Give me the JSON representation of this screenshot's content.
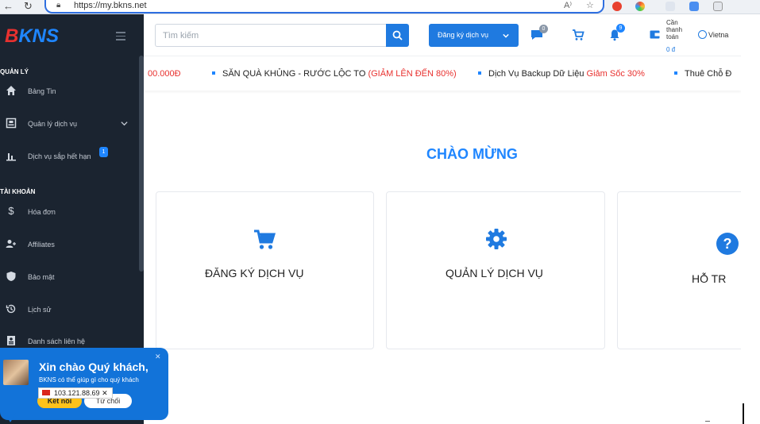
{
  "browser": {
    "url": "https://my.bkns.net"
  },
  "sidebar": {
    "logo_b": "B",
    "logo_rest": "KNS",
    "sections": [
      {
        "title": "QUẢN LÝ",
        "items": [
          {
            "label": "Bảng Tin",
            "icon": "home-icon"
          },
          {
            "label": "Quản lý dịch vụ",
            "icon": "id-card-icon"
          },
          {
            "label": "Dịch vụ sắp hết hạn",
            "icon": "bar-chart-icon",
            "badge": "1"
          }
        ]
      },
      {
        "title": "TÀI KHOẢN",
        "items": [
          {
            "label": "Hóa đơn",
            "icon": "dollar-icon"
          },
          {
            "label": "Affiliates",
            "icon": "users-icon"
          },
          {
            "label": "Bảo mật",
            "icon": "shield-icon"
          },
          {
            "label": "Lịch sử",
            "icon": "history-icon"
          },
          {
            "label": "Danh sách liên hệ",
            "icon": "contact-list-icon"
          }
        ]
      }
    ]
  },
  "header": {
    "search_placeholder": "Tìm kiếm",
    "register_label": "Đăng ký dịch vụ",
    "chat_badge": "0",
    "notif_badge": "9",
    "wallet_label": "Cần thanh toán",
    "wallet_value": "0 đ",
    "language": "Vietna"
  },
  "ticker": {
    "item0": "00.000Đ",
    "item1_prefix": "SĂN QUÀ KHỦNG - RƯỚC LỘC TO",
    "item1_red": "(GIẢM LÊN ĐẾN 80%)",
    "item2_prefix": "Dịch Vụ Backup Dữ Liệu",
    "item2_red": "Giảm Sốc 30%",
    "item3": "Thuê Chỗ Đ"
  },
  "main": {
    "welcome": "CHÀO MỪNG",
    "cards": [
      {
        "title": "ĐĂNG KÝ DỊCH VỤ",
        "icon": "cart-icon"
      },
      {
        "title": "QUẢN LÝ DỊCH VỤ",
        "icon": "gear-icon"
      },
      {
        "title": "HỖ TR",
        "icon": "help-icon"
      }
    ]
  },
  "chat": {
    "title": "Xin chào Quý khách,",
    "subtitle": "BKNS có thể giúp gì cho quý khách",
    "connect": "Kết nối",
    "refuse": "Từ chối",
    "ip": "103.121.88.69",
    "ip_close": "✕",
    "close": "✕"
  },
  "colors": {
    "accent": "#1f86ff",
    "sidebar_bg": "#1b2430",
    "brand_red": "#e8312f",
    "chat_bg": "#1273d9",
    "connect_yellow": "#ffc21a"
  }
}
